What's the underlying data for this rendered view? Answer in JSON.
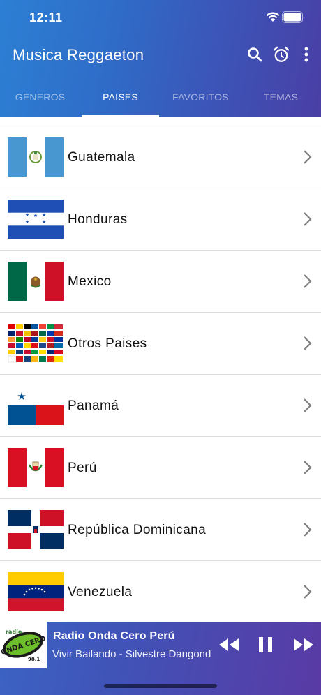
{
  "status_bar": {
    "time": "12:11"
  },
  "app_bar": {
    "title": "Musica Reggaeton"
  },
  "tabs": [
    {
      "label": "GENEROS"
    },
    {
      "label": "PAISES"
    },
    {
      "label": "FAVORITOS"
    },
    {
      "label": "TEMAS"
    }
  ],
  "countries": [
    {
      "label": "Guatemala"
    },
    {
      "label": "Honduras"
    },
    {
      "label": "Mexico"
    },
    {
      "label": "Otros Paises"
    },
    {
      "label": "Panamá"
    },
    {
      "label": "Perú"
    },
    {
      "label": "República Dominicana"
    },
    {
      "label": "Venezuela"
    }
  ],
  "player": {
    "station": "Radio Onda Cero Perú",
    "track": "Vivir Bailando - Silvestre Dangond",
    "logo_text": "ONDA CERO",
    "logo_sub": "98.1",
    "logo_radio": "radio"
  },
  "colors": {
    "header_start": "#2c7fd4",
    "header_end": "#4a3fa5",
    "player_end": "#5a3aa5"
  }
}
